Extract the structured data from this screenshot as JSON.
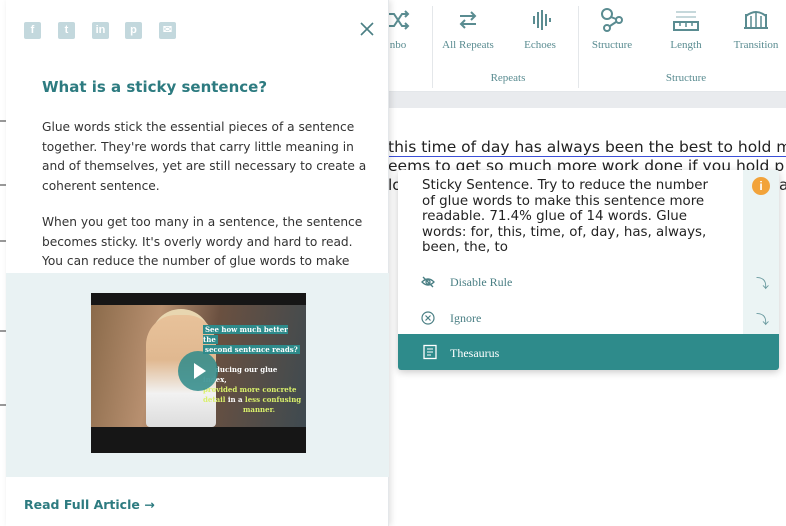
{
  "toolbar": {
    "tools": [
      {
        "label": "nbo",
        "icon": "combo-icon"
      },
      {
        "label": "All Repeats",
        "icon": "all-repeats-icon"
      },
      {
        "label": "Echoes",
        "icon": "echoes-icon"
      },
      {
        "label": "Structure",
        "icon": "structure-icon"
      },
      {
        "label": "Length",
        "icon": "length-icon"
      },
      {
        "label": "Transition",
        "icon": "transition-icon"
      }
    ],
    "groups": {
      "repeats": "Repeats",
      "structure": "Structure"
    }
  },
  "editor": {
    "line1": "this time of day has always been the best to hold m",
    "line2": "eems to get so much more work done if you hold p",
    "line3": "lo"
  },
  "card": {
    "message": "Sticky Sentence. Try to reduce the number of glue words to make this sentence more readable. 71.4% glue of 14 words. Glue words: for, this, time, of, day, has, always, been, the, to",
    "info_glyph": "i",
    "disable_label": "Disable Rule",
    "ignore_label": "Ignore",
    "thesaurus_label": "Thesaurus",
    "edge_letter": "a",
    "accent_color": "#2e8b8b",
    "info_color": "#f2a33a"
  },
  "panel": {
    "share": [
      {
        "name": "facebook-icon",
        "glyph": "f"
      },
      {
        "name": "twitter-icon",
        "glyph": "t"
      },
      {
        "name": "linkedin-icon",
        "glyph": "in"
      },
      {
        "name": "pinterest-icon",
        "glyph": "p"
      },
      {
        "name": "email-icon",
        "glyph": "✉"
      }
    ],
    "title": "What is a sticky sentence?",
    "para1": "Glue words stick the essential pieces of a sentence together. They're words that carry little meaning in and of themselves, yet are still necessary to create a coherent sentence.",
    "para2": "When you get too many in a sentence, the sentence becomes sticky. It's overly wordy and hard to read. You can reduce the number of glue words to make your",
    "video": {
      "line1": "See how much better the",
      "line2": "second sentence reads?",
      "line3": "ducing our glue index,",
      "line4a": "provided",
      "line4b": "more concrete",
      "line5a": "detail",
      "line5b": "in a",
      "line5c": "less confusing",
      "line6": "manner."
    },
    "read_more": "Read Full Article →"
  }
}
